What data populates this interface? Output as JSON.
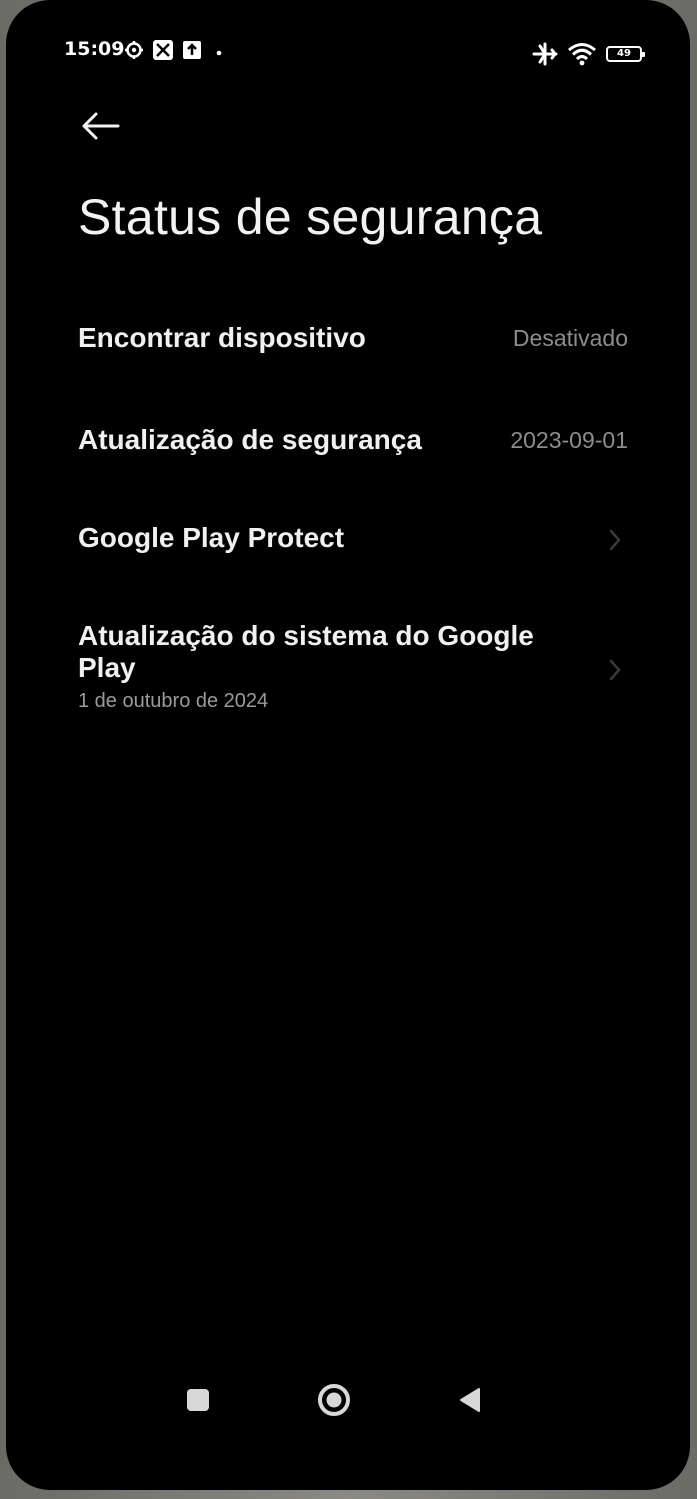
{
  "status_bar": {
    "time": "15:09",
    "battery_level": "49",
    "left_icons": [
      "settings-gear-icon",
      "nfc-icon",
      "upload-icon",
      "notification-dot-icon"
    ],
    "right_icons": [
      "airplane-mode-icon",
      "wifi-icon",
      "battery-icon"
    ]
  },
  "header": {
    "back_icon": "arrow-left-icon",
    "title": "Status de segurança"
  },
  "settings": {
    "items": [
      {
        "label": "Encontrar dispositivo",
        "value": "Desativado"
      },
      {
        "label": "Atualização de segurança",
        "value": "2023-09-01"
      },
      {
        "label": "Google Play Protect",
        "value": "",
        "icon": "chevron-right-icon"
      },
      {
        "label": "Atualização do sistema do Google Play",
        "subtitle": "1 de outubro de 2024",
        "icon": "chevron-right-icon"
      }
    ]
  },
  "nav_bar": {
    "buttons": [
      "recents-square-icon",
      "home-circle-icon",
      "back-triangle-icon"
    ]
  },
  "colors": {
    "background": "#000000",
    "text_primary": "#f0f0f0",
    "text_secondary": "#8d8d8d",
    "chevron": "#3a3a3a"
  }
}
